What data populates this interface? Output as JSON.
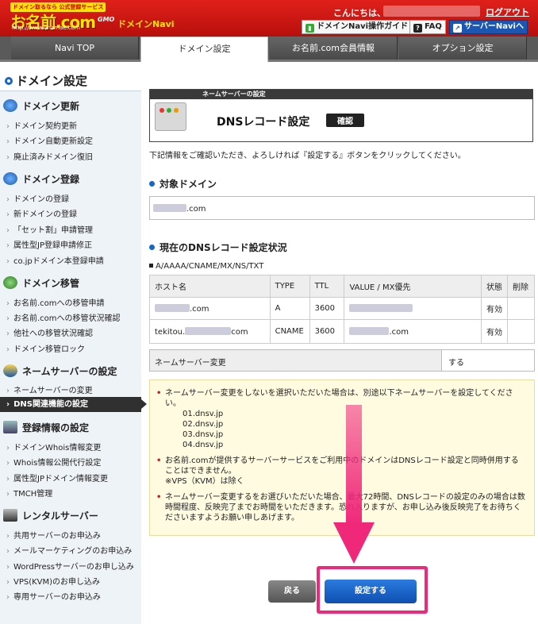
{
  "header": {
    "logo_tag": "ドメイン取るなら 公式登録サービス",
    "logo_main": "お名前.com",
    "logo_url": "http://www.onamae.com",
    "logo_gmo": "GMO",
    "brand": "ドメインNavi",
    "greeting": "こんにちは、",
    "logout": "ログアウト",
    "guide_btn": "ドメインNavi操作ガイド",
    "faq_btn": "FAQ",
    "server_btn": "サーバーNaviへ"
  },
  "tabs": [
    {
      "label": "Navi TOP"
    },
    {
      "label": "ドメイン設定"
    },
    {
      "label": "お名前.com会員情報"
    },
    {
      "label": "オプション設定"
    }
  ],
  "sidebar": {
    "title": "ドメイン設定",
    "sections": [
      {
        "title": "ドメイン更新",
        "items": [
          "ドメイン契約更新",
          "ドメイン自動更新設定",
          "廃止済みドメイン復旧"
        ]
      },
      {
        "title": "ドメイン登録",
        "items": [
          "ドメインの登録",
          "新ドメインの登録",
          "「セット割」申請管理",
          "属性型JP登録申請修正",
          "co.jpドメイン本登録申請"
        ]
      },
      {
        "title": "ドメイン移管",
        "items": [
          "お名前.comへの移管申請",
          "お名前.comへの移管状況確認",
          "他社への移管状況確認",
          "ドメイン移管ロック"
        ]
      },
      {
        "title": "ネームサーバーの設定",
        "items": [
          "ネームサーバーの変更",
          "DNS関連機能の設定"
        ]
      },
      {
        "title": "登録情報の設定",
        "items": [
          "ドメインWhois情報変更",
          "Whois情報公開代行設定",
          "属性型JPドメイン情報変更",
          "TMCH管理"
        ]
      },
      {
        "title": "レンタルサーバー",
        "items": [
          "共用サーバーのお申込み",
          "メールマーケティングのお申込み",
          "WordPressサーバーのお申し込み",
          "VPS(KVM)のお申し込み",
          "専用サーバーのお申込み"
        ]
      }
    ]
  },
  "panel": {
    "header": "ネームサーバーの設定",
    "title": "DNSレコード設定",
    "badge": "確認"
  },
  "instruction": "下記情報をご確認いただき、よろしければ『設定する』ボタンをクリックしてください。",
  "target_domain": {
    "heading": "対象ドメイン",
    "suffix": ".com"
  },
  "dns_status": {
    "heading": "現在のDNSレコード設定状況",
    "record_types": "A/AAAA/CNAME/MX/NS/TXT",
    "columns": [
      "ホスト名",
      "TYPE",
      "TTL",
      "VALUE / MX優先",
      "状態",
      "削除"
    ],
    "rows": [
      {
        "host_prefix": "",
        "host_suffix": ".com",
        "type": "A",
        "ttl": "3600",
        "value_suffix": "",
        "status": "有効"
      },
      {
        "host_prefix": "tekitou.",
        "host_suffix": "com",
        "type": "CNAME",
        "ttl": "3600",
        "value_suffix": ".com",
        "status": "有効"
      }
    ]
  },
  "ns_change": {
    "label": "ネームサーバー変更",
    "value": "する"
  },
  "notices": {
    "n1_text": "ネームサーバー変更をしないを選択いただいた場合は、別途以下ネームサーバーを設定してください。",
    "ns_list": [
      "01.dnsv.jp",
      "02.dnsv.jp",
      "03.dnsv.jp",
      "04.dnsv.jp"
    ],
    "n2_text": "お名前.comが提供するサーバーサービスをご利用中のドメインはDNSレコード設定と同時併用することはできません。",
    "n2_sub": "※VPS（KVM）は除く",
    "n3_text": "ネームサーバー変更するをお選びいただいた場合、最大72時間、DNSレコードの設定のみの場合は数時間程度、反映完了までお時間をいただきます。恐れ入りますが、お申し込み後反映完了をお待ちくださいますようお願い申しあげます。"
  },
  "buttons": {
    "back": "戻る",
    "submit": "設定する"
  },
  "colors": {
    "brand_red": "#d4181a",
    "accent_blue": "#1866c3",
    "highlight_pink": "#f0287a"
  }
}
